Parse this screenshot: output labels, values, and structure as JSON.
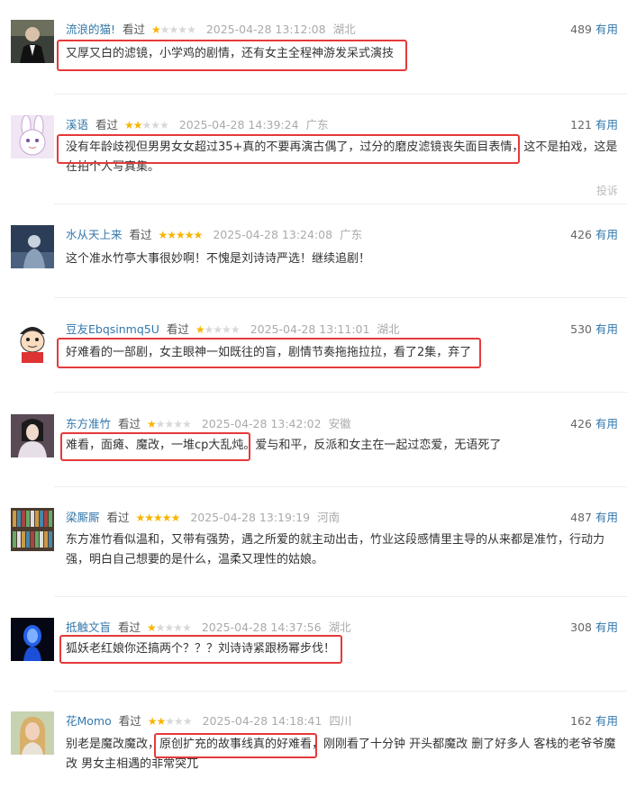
{
  "useful_label": "有用",
  "watched_label": "看过",
  "report_label": "投诉",
  "colors": {
    "username": "#3377aa",
    "star": "#f7b500",
    "highlight_box": "#e53a3a"
  },
  "comments": [
    {
      "username": "流浪的猫!",
      "status": "看过",
      "rating": 1,
      "time": "2025-04-28 13:12:08",
      "location": "湖北",
      "useful": "489",
      "text": "又厚又白的滤镜，小学鸡的剧情，还有女主全程神游发呆式演技",
      "avatar_icon": "dark-suited-man-avatar"
    },
    {
      "username": "溪语",
      "status": "看过",
      "rating": 2,
      "time": "2025-04-28 14:39:24",
      "location": "广东",
      "useful": "121",
      "text": "没有年龄歧视但男男女女超过35+真的不要再演古偶了，过分的磨皮滤镜丧失面目表情，这不是拍戏，这是在拍个人写真集。",
      "avatar_icon": "white-rabbit-avatar"
    },
    {
      "username": "水从天上来",
      "status": "看过",
      "rating": 5,
      "time": "2025-04-28 13:24:08",
      "location": "广东",
      "useful": "426",
      "text": "这个准水竹亭大事很妙啊！不愧是刘诗诗严选！继续追剧！",
      "avatar_icon": "night-figure-avatar"
    },
    {
      "username": "豆友Ebqsinmq5U",
      "status": "看过",
      "rating": 1,
      "time": "2025-04-28 13:11:01",
      "location": "湖北",
      "useful": "530",
      "text": "好难看的一部剧，女主眼神一如既往的盲，剧情节奏拖拖拉拉，看了2集，弃了",
      "avatar_icon": "cartoon-boy-avatar"
    },
    {
      "username": "东方准竹",
      "status": "看过",
      "rating": 1,
      "time": "2025-04-28 13:42:02",
      "location": "安徽",
      "useful": "426",
      "text": "难看，面瘫、魔改，一堆cp大乱炖。爱与和平，反派和女主在一起过恋爱，无语死了",
      "avatar_icon": "costume-woman-avatar"
    },
    {
      "username": "梁厮厮",
      "status": "看过",
      "rating": 5,
      "time": "2025-04-28 13:19:19",
      "location": "河南",
      "useful": "487",
      "text": "东方准竹看似温和，又带有强势，遇之所爱的就主动出击，竹业这段感情里主导的从来都是准竹，行动力强，明白自己想要的是什么，温柔又理性的姑娘。",
      "avatar_icon": "bookshelf-avatar"
    },
    {
      "username": "抵触文盲",
      "status": "看过",
      "rating": 1,
      "time": "2025-04-28 14:37:56",
      "location": "湖北",
      "useful": "308",
      "text": "狐妖老红娘你还搞两个？？？刘诗诗紧跟杨幂步伐！",
      "avatar_icon": "blue-glow-head-avatar"
    },
    {
      "username": "花Momo",
      "status": "看过",
      "rating": 2,
      "time": "2025-04-28 14:18:41",
      "location": "四川",
      "useful": "162",
      "text": "别老是魔改魔改，原创扩充的故事线真的好难看，刚刚看了十分钟 开头都魔改 删了好多人 客栈的老爷爷魔改 男女主相遇的非常突兀",
      "avatar_icon": "blonde-woman-avatar"
    }
  ]
}
